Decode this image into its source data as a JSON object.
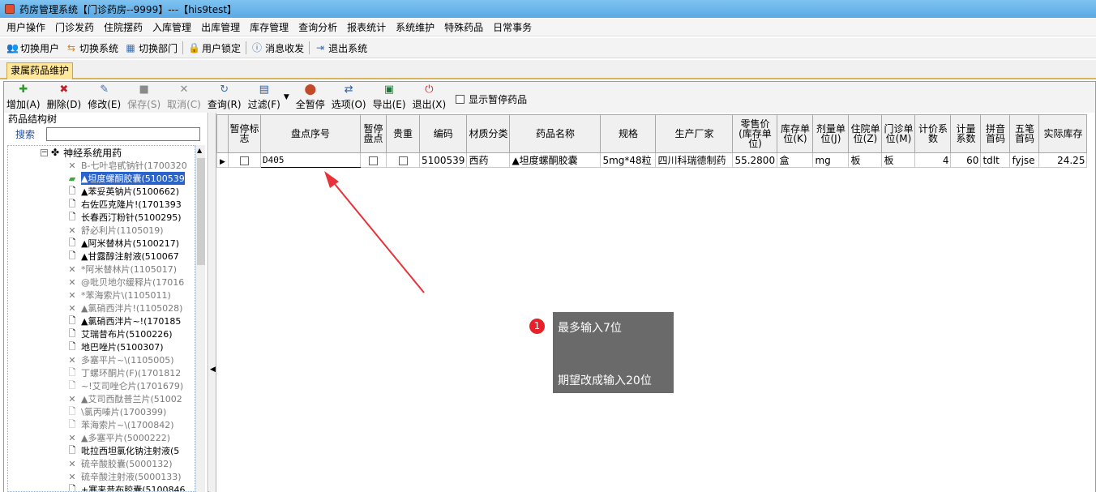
{
  "window": {
    "title": "药房管理系统【门诊药房--9999】---【his9test】"
  },
  "menu": [
    "用户操作",
    "门诊发药",
    "住院摆药",
    "入库管理",
    "出库管理",
    "库存管理",
    "查询分析",
    "报表统计",
    "系统维护",
    "特殊药品",
    "日常事务"
  ],
  "toolbar1": {
    "switch_user": "切换用户",
    "switch_system": "切换系统",
    "switch_dept": "切换部门",
    "lock_user": "用户锁定",
    "messages": "消息收发",
    "exit_system": "退出系统"
  },
  "tab": {
    "label": "隶属药品维护"
  },
  "toolbar2": {
    "add": "增加(A)",
    "delete": "删除(D)",
    "modify": "修改(E)",
    "save": "保存(S)",
    "cancel": "取消(C)",
    "query": "查询(R)",
    "filter": "过滤(F)",
    "suspend_all": "全暂停",
    "options": "选项(O)",
    "export": "导出(E)",
    "quit": "退出(X)",
    "show_suspended": "显示暂停药品"
  },
  "left_panel": {
    "title": "药品结构树",
    "search_label": "搜索",
    "root": "神经系统用药",
    "items": [
      "B-七叶皂甙钠针(1700320",
      "▲坦度螺酮胶囊(5100539",
      "▲苯妥英钠片(5100662)",
      "右佐匹克隆片!(1701393",
      "长春西汀粉针(5100295)",
      "舒必利片(1105019)",
      "▲阿米替林片(5100217)",
      "▲甘露醇注射液(510067",
      "*阿米替林片(1105017)",
      "@吡贝地尔缓释片(17016",
      "*苯海索片\\(1105011)",
      "▲氯硝西泮片!(1105028)",
      "▲氯硝西泮片~!(170185",
      "艾瑞昔布片(5100226)",
      "地巴唑片(5100307)",
      "多塞平片~\\(1105005)",
      "丁螺环酮片(F)(1701812",
      "~!艾司唑仑片(1701679)",
      "▲艾司西酞普兰片(51002",
      "\\氯丙嗪片(1700399)",
      "苯海索片~\\(1700842)",
      "▲多塞平片(5000222)",
      "吡拉西坦氯化钠注射液(5",
      "硫辛酸胶囊(5000132)",
      "硫辛酸注射液(5000133)",
      "+塞来昔布胶囊(5100846"
    ]
  },
  "grid": {
    "headers": [
      "暂停标志",
      "盘点序号",
      "暂停盘点",
      "贵重",
      "编码",
      "材质分类",
      "药品名称",
      "规格",
      "生产厂家",
      "零售价(库存单位)",
      "库存单位(K)",
      "剂量单位(J)",
      "住院单位(Z)",
      "门诊单位(M)",
      "计价系数",
      "计量系数",
      "拼音首码",
      "五笔首码",
      "实际库存"
    ],
    "row": {
      "count_no": "D405",
      "code": "5100539",
      "category": "西药",
      "name": "▲坦度螺酮胶囊",
      "spec": "5mg*48粒",
      "maker": "四川科瑞德制药",
      "price": "55.2800",
      "stock_unit": "盒",
      "dose_unit": "mg",
      "inpatient_unit": "板",
      "outpatient_unit": "板",
      "price_factor": "4",
      "measure_factor": "60",
      "pinyin": "tdlt",
      "wubi": "fyjse",
      "stock": "24.25"
    }
  },
  "annotation": {
    "badge": "1",
    "line1": "最多输入7位",
    "line2": "期望改成输入20位",
    "arrow_color": "#e8323a"
  }
}
